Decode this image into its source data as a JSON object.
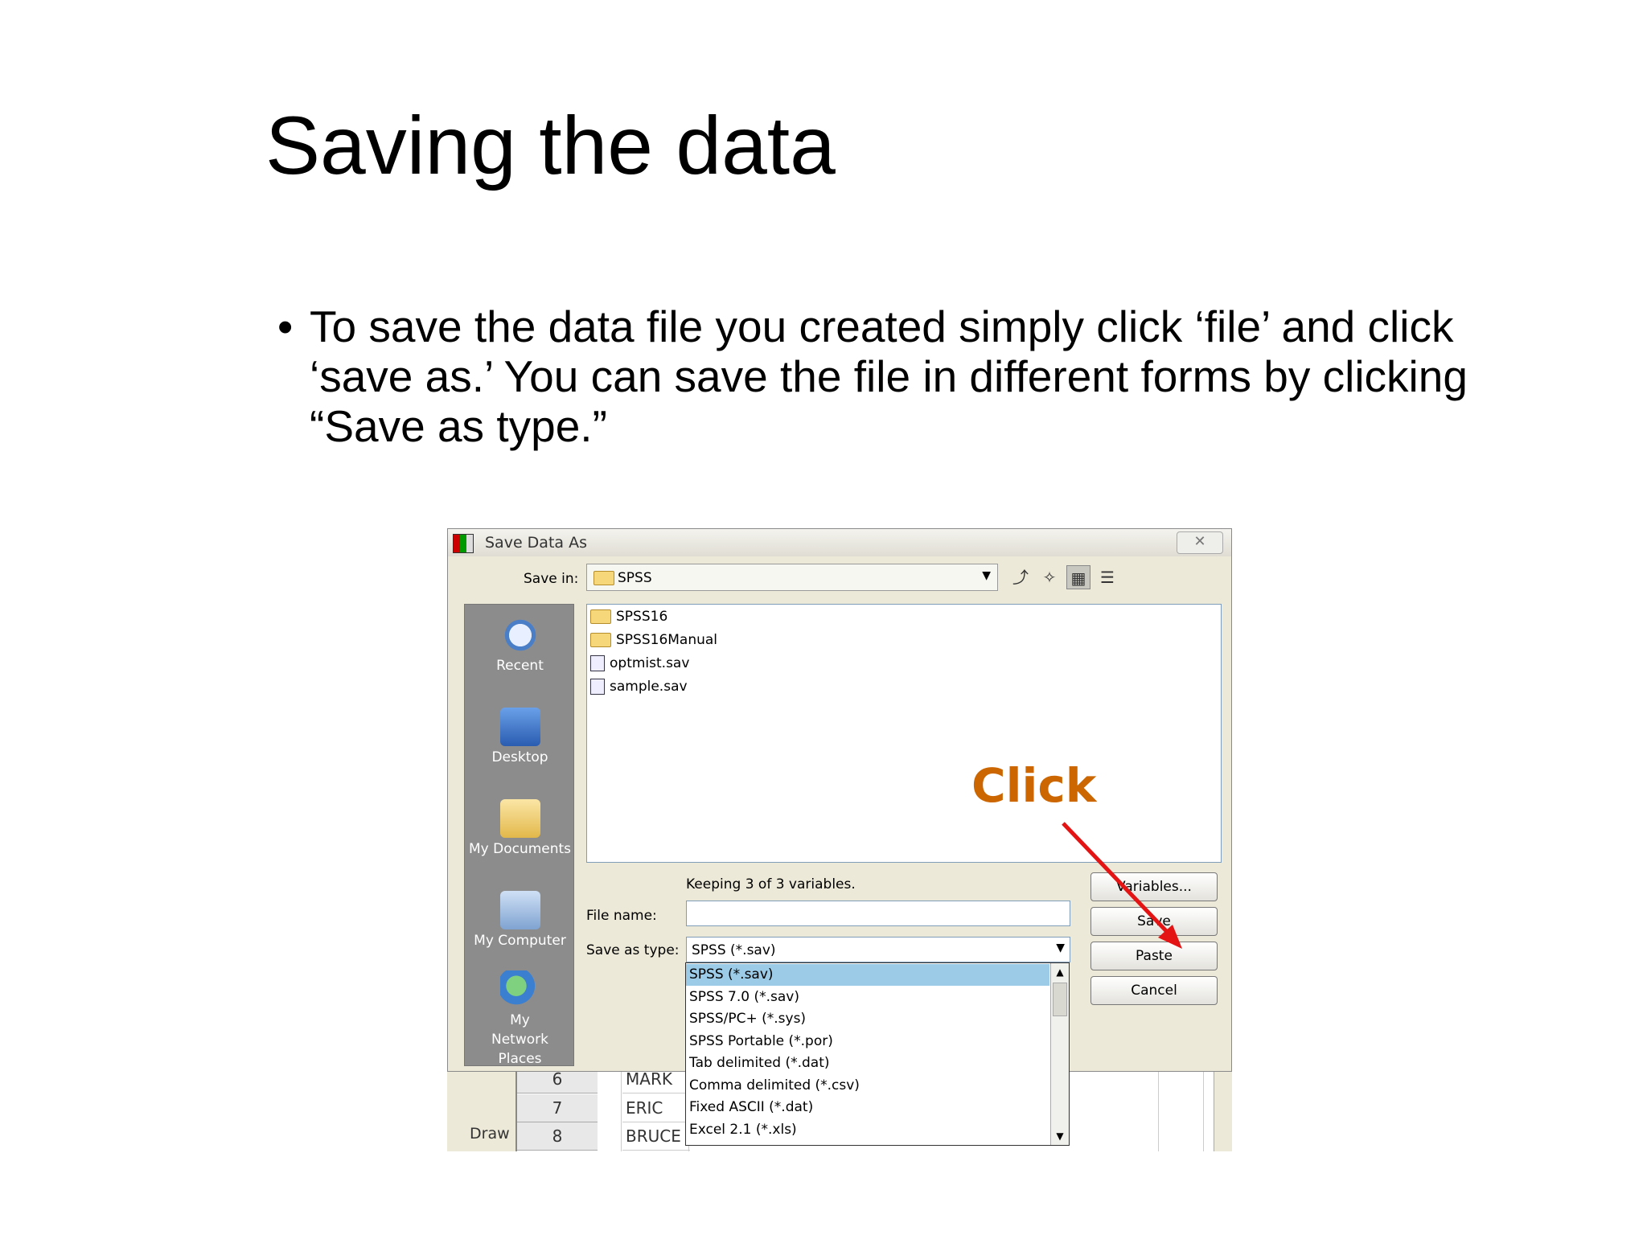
{
  "slide": {
    "title": "Saving the data",
    "bullet": "To save the data file you created simply click ‘file’ and click ‘save as.’ You can save the file in different forms by clicking “Save as type.”",
    "annotation": "Click",
    "annotation_color": "#cc6600",
    "arrow_color": "#e51414"
  },
  "dialog": {
    "title": "Save Data As",
    "close_label": "✕",
    "save_in_label": "Save in:",
    "save_in_value": "SPSS",
    "places": [
      "Recent",
      "Desktop",
      "My Documents",
      "My Computer",
      "My Network Places"
    ],
    "files": [
      {
        "name": "SPSS16",
        "type": "folder"
      },
      {
        "name": "SPSS16Manual",
        "type": "folder"
      },
      {
        "name": "optmist.sav",
        "type": "sav"
      },
      {
        "name": "sample.sav",
        "type": "sav"
      }
    ],
    "keeping_text": "Keeping 3 of 3 variables.",
    "file_name_label": "File name:",
    "file_name_value": "",
    "save_as_type_label": "Save as type:",
    "save_as_type_value": "SPSS (*.sav)",
    "type_options": [
      "SPSS (*.sav)",
      "SPSS 7.0 (*.sav)",
      "SPSS/PC+ (*.sys)",
      "SPSS Portable (*.por)",
      "Tab delimited (*.dat)",
      "Comma delimited (*.csv)",
      "Fixed ASCII (*.dat)",
      "Excel 2.1 (*.xls)"
    ],
    "buttons": {
      "variables": "Variables...",
      "save": "Save",
      "paste": "Paste",
      "cancel": "Cancel"
    }
  },
  "sheet": {
    "rows": [
      {
        "num": "6",
        "name": "MARK"
      },
      {
        "num": "7",
        "name": "ERIC"
      },
      {
        "num": "8",
        "name": "BRUCE"
      }
    ],
    "draw_label": "Draw"
  }
}
